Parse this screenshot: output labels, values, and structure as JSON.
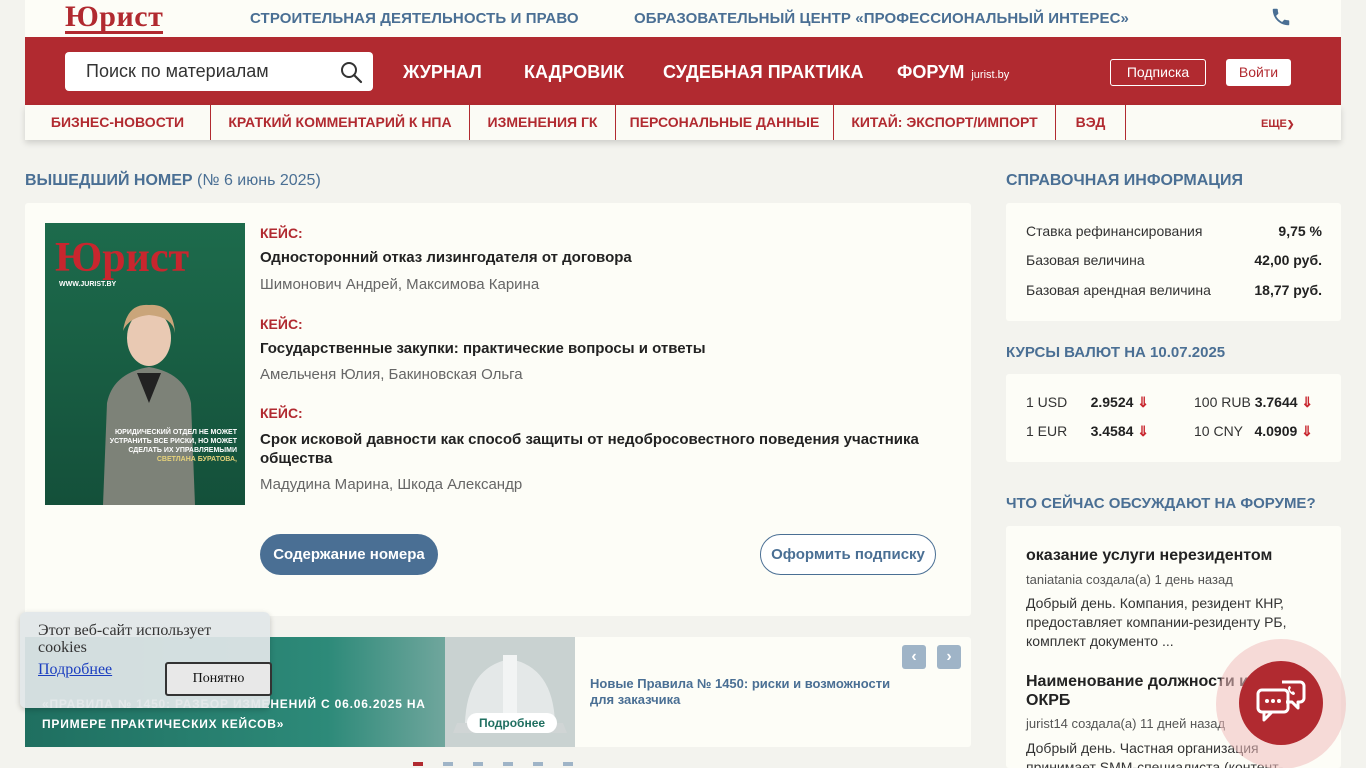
{
  "header": {
    "logo": "Юрист",
    "top_links": [
      "СТРОИТЕЛЬНАЯ ДЕЯТЕЛЬНОСТЬ И ПРАВО",
      "ОБРАЗОВАТЕЛЬНЫЙ ЦЕНТР «ПРОФЕССИОНАЛЬНЫЙ ИНТЕРЕС»"
    ],
    "phone_icon": "phone-icon",
    "search_placeholder": "Поиск по материалам",
    "nav": [
      "ЖУРНАЛ",
      "КАДРОВИК",
      "СУДЕБНАЯ ПРАКТИКА",
      "ФОРУМ"
    ],
    "forum_suffix": "jurist.by",
    "subscribe_label": "Подписка",
    "login_label": "Войти",
    "categories": [
      "БИЗНЕС-НОВОСТИ",
      "КРАТКИЙ КОММЕНТАРИЙ К НПА",
      "ИЗМЕНЕНИЯ ГК",
      "ПЕРСОНАЛЬНЫЕ ДАННЫЕ",
      "КИТАЙ: ЭКСПОРТ/ИМПОРТ",
      "ВЭД"
    ],
    "more_label": "ЕЩЕ"
  },
  "issue": {
    "section_title": "ВЫШЕДШИЙ НОМЕР",
    "issue_label": "(№ 6 июнь 2025)",
    "cover": {
      "logo": "Юрист",
      "site": "WWW.JURIST.BY",
      "caption": "ЮРИДИЧЕСКИЙ ОТДЕЛ НЕ МОЖЕТ УСТРАНИТЬ ВСЕ РИСКИ, НО МОЖЕТ СДЕЛАТЬ ИХ УПРАВЛЯЕМЫМИ",
      "person_name": "СВЕТЛАНА БУРАТОВА,"
    },
    "cases": [
      {
        "label": "КЕЙС:",
        "title": "Односторонний отказ лизингодателя от договора",
        "authors": "Шимонович Андрей, Максимова Карина"
      },
      {
        "label": "КЕЙС:",
        "title": "Государственные закупки: практические вопросы и ответы",
        "authors": "Амельченя Юлия, Бакиновская Ольга"
      },
      {
        "label": "КЕЙС:",
        "title": "Срок исковой давности как способ защиты от недобросовестного поведения участника общества",
        "authors": "Мадудина Марина, Шкода Александр"
      }
    ],
    "contents_button": "Содержание номера",
    "subscribe_button": "Оформить подписку"
  },
  "banner": {
    "headline": "«ПРАВИЛА № 1450: РАЗБОР ИЗМЕНЕНИЙ С 06.06.2025 НА ПРИМЕРЕ ПРАКТИЧЕСКИХ КЕЙСОВ»",
    "more_button": "Подробнее",
    "caption": "Новые Правила № 1450: риски и возможности для заказчика",
    "prev": "‹",
    "next": "›"
  },
  "reference": {
    "title": "СПРАВОЧНАЯ ИНФОРМАЦИЯ",
    "rows": [
      {
        "label": "Ставка рефинансирования",
        "value": "9,75 %"
      },
      {
        "label": "Базовая величина",
        "value": "42,00 руб."
      },
      {
        "label": "Базовая арендная величина",
        "value": "18,77 руб."
      }
    ]
  },
  "rates": {
    "title": "КУРСЫ ВАЛЮТ НА 10.07.2025",
    "items": [
      {
        "label": "1 USD",
        "value": "2.9524",
        "trend": "⇓"
      },
      {
        "label": "100 RUB",
        "value": "3.7644",
        "trend": "⇓"
      },
      {
        "label": "1 EUR",
        "value": "3.4584",
        "trend": "⇓"
      },
      {
        "label": "10 CNY",
        "value": "4.0909",
        "trend": "⇓"
      }
    ]
  },
  "forum": {
    "title": "ЧТО СЕЙЧАС ОБСУЖДАЮТ НА ФОРУМЕ?",
    "topics": [
      {
        "title": "оказание услуги нерезидентом",
        "meta": "taniatania создала(а) 1 день назад",
        "text": "Добрый день. Компания, резидент КНР, предоставляет компании-резиденту РБ, комплект документо ..."
      },
      {
        "title": "Наименование должности и код ОКРБ",
        "meta": "jurist14 создала(а) 11 дней назад",
        "text": "Добрый день. Частная организация принимает SMM-специалиста (контент-"
      }
    ]
  },
  "cookie": {
    "text": "Этот веб-сайт использует cookies",
    "link": "Подробнее",
    "button": "Понятно"
  },
  "colors": {
    "brand": "#b12a30",
    "accent": "#4a6f94",
    "background": "#f3f3ee"
  }
}
